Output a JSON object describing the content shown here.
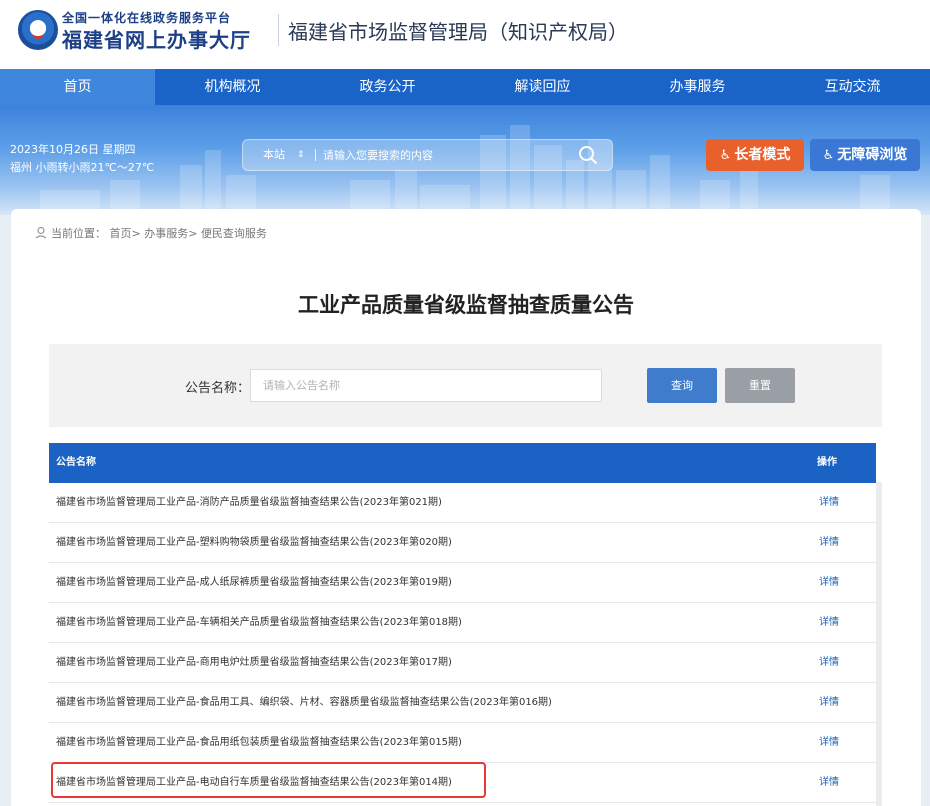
{
  "header": {
    "platform_line": "全国一体化在线政务服务平台",
    "hall_name": "福建省网上办事大厅",
    "bureau_name": "福建省市场监督管理局（知识产权局）"
  },
  "nav": {
    "items": [
      {
        "label": "首页",
        "active": true
      },
      {
        "label": "机构概况",
        "active": false
      },
      {
        "label": "政务公开",
        "active": false
      },
      {
        "label": "解读回应",
        "active": false
      },
      {
        "label": "办事服务",
        "active": false
      },
      {
        "label": "互动交流",
        "active": false
      }
    ]
  },
  "banner": {
    "date": "2023年10月26日 星期四",
    "weather": "福州 小雨转小雨21℃～27℃",
    "search_scope": "本站",
    "search_placeholder": "请输入您要搜索的内容",
    "elder_mode_label": "长者模式",
    "accessible_label": "无障碍浏览"
  },
  "breadcrumb": {
    "prefix": "当前位置：",
    "items": [
      "首页",
      "办事服务",
      "便民查询服务"
    ],
    "separator": ">"
  },
  "page": {
    "title": "工业产品质量省级监督抽查质量公告"
  },
  "filter": {
    "label": "公告名称：",
    "placeholder": "请输入公告名称",
    "query_label": "查询",
    "reset_label": "重置"
  },
  "table": {
    "col_name": "公告名称",
    "col_op": "操作",
    "rows": [
      {
        "name": "福建省市场监督管理局工业产品-消防产品质量省级监督抽查结果公告(2023年第021期)",
        "op": "详情"
      },
      {
        "name": "福建省市场监督管理局工业产品-塑料购物袋质量省级监督抽查结果公告(2023年第020期)",
        "op": "详情"
      },
      {
        "name": "福建省市场监督管理局工业产品-成人纸尿裤质量省级监督抽查结果公告(2023年第019期)",
        "op": "详情"
      },
      {
        "name": "福建省市场监督管理局工业产品-车辆相关产品质量省级监督抽查结果公告(2023年第018期)",
        "op": "详情"
      },
      {
        "name": "福建省市场监督管理局工业产品-商用电炉灶质量省级监督抽查结果公告(2023年第017期)",
        "op": "详情"
      },
      {
        "name": "福建省市场监督管理局工业产品-食品用工具、编织袋、片材、容器质量省级监督抽查结果公告(2023年第016期)",
        "op": "详情"
      },
      {
        "name": "福建省市场监督管理局工业产品-食品用纸包装质量省级监督抽查结果公告(2023年第015期)",
        "op": "详情"
      },
      {
        "name": "福建省市场监督管理局工业产品-电动自行车质量省级监督抽查结果公告(2023年第014期)",
        "op": "详情"
      }
    ]
  },
  "colors": {
    "nav_blue": "#1a63c7",
    "elder_orange": "#e8602c",
    "highlight_red": "#e53935"
  }
}
